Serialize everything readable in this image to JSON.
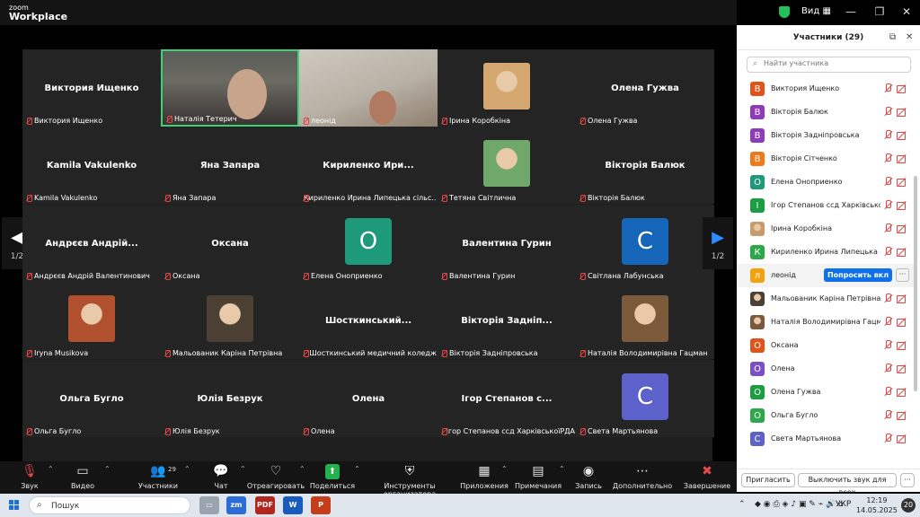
{
  "titlebar": {
    "brand_top": "zoom",
    "brand_bottom": "Workplace",
    "view_label": "Вид"
  },
  "gallery": {
    "page_left": "1/2",
    "page_right": "1/2",
    "tiles": [
      {
        "name": "Виктория  Ищенко",
        "label": "Виктория Ищенко",
        "kind": "name"
      },
      {
        "name": "",
        "label": "Наталія Тетерич",
        "kind": "video1"
      },
      {
        "name": "",
        "label": "леонід",
        "kind": "video2"
      },
      {
        "name": "",
        "label": "Ірина Коробкіна",
        "kind": "photo",
        "photo_color": "#d4a770"
      },
      {
        "name": "Олена Гужва",
        "label": "Олена Гужва",
        "kind": "name"
      },
      {
        "name": "Kamila Vakulenko",
        "label": "Kamila Vakulenko",
        "kind": "name"
      },
      {
        "name": "Яна Запара",
        "label": "Яна Запара",
        "kind": "name"
      },
      {
        "name": "Кириленко  Ири...",
        "label": "Кириленко Ирина Липецька сільс...",
        "kind": "name"
      },
      {
        "name": "",
        "label": "Тетяна Світлична",
        "kind": "photo",
        "photo_color": "#6fa86a"
      },
      {
        "name": "Вікторія Балюк",
        "label": "Вікторія Балюк",
        "kind": "name"
      },
      {
        "name": "Андрєєв  Андрій...",
        "label": "Андрєєв Андрій Валентинович",
        "kind": "name"
      },
      {
        "name": "Оксана",
        "label": "Оксана",
        "kind": "name"
      },
      {
        "name": "",
        "label": "Елена Оноприенко",
        "kind": "avatar",
        "letter": "О",
        "color": "#1e9a7a"
      },
      {
        "name": "Валентина Гурин",
        "label": "Валентина Гурин",
        "kind": "name"
      },
      {
        "name": "",
        "label": "Світлана Лабунська",
        "kind": "avatar",
        "letter": "С",
        "color": "#1565b8"
      },
      {
        "name": "",
        "label": "Iryna Musikova",
        "kind": "photo",
        "photo_color": "#b0502e"
      },
      {
        "name": "",
        "label": "Мальованик Каріна Петрівна",
        "kind": "photo",
        "photo_color": "#4c4034"
      },
      {
        "name": "Шосткинський...",
        "label": "Шосткинський медичний коледж",
        "kind": "name"
      },
      {
        "name": "Вікторія  Задніп...",
        "label": "Вікторія Задніпровська",
        "kind": "name"
      },
      {
        "name": "",
        "label": "Наталія Володимирівна Гацман",
        "kind": "photo",
        "photo_color": "#7a5a3a"
      },
      {
        "name": "Ольга Бугло",
        "label": "Ольга Бугло",
        "kind": "name"
      },
      {
        "name": "Юлія Безрук",
        "label": "Юлія Безрук",
        "kind": "name"
      },
      {
        "name": "Олена",
        "label": "Олена",
        "kind": "name"
      },
      {
        "name": "Ігор  Степанов  с...",
        "label": "Ігор Степанов ссд ХарківськоїРДА",
        "kind": "name"
      },
      {
        "name": "",
        "label": "Света Мартьянова",
        "kind": "avatar",
        "letter": "С",
        "color": "#5c62c9"
      }
    ]
  },
  "toolbar": {
    "items": [
      {
        "label": "Звук",
        "icon": "mic-muted-icon",
        "glyph": "🎙"
      },
      {
        "label": "Видео",
        "icon": "video-icon",
        "glyph": "▭"
      },
      {
        "label": "Участники",
        "icon": "participants-icon",
        "glyph": "👥",
        "count": "29"
      },
      {
        "label": "Чат",
        "icon": "chat-icon",
        "glyph": "💬"
      },
      {
        "label": "Отреагировать",
        "icon": "heart-icon",
        "glyph": "♡"
      },
      {
        "label": "Поделиться",
        "icon": "share-icon",
        "glyph": "⬆"
      },
      {
        "label": "Инструменты организатора",
        "icon": "shield-icon",
        "glyph": "⛨"
      },
      {
        "label": "Приложения",
        "icon": "apps-icon",
        "glyph": "▦"
      },
      {
        "label": "Примечания",
        "icon": "notes-icon",
        "glyph": "▤"
      },
      {
        "label": "Запись",
        "icon": "record-icon",
        "glyph": "◉"
      },
      {
        "label": "Дополнительно",
        "icon": "more-icon",
        "glyph": "⋯"
      },
      {
        "label": "Завершение",
        "icon": "end-icon",
        "glyph": "✖"
      }
    ]
  },
  "panel": {
    "title": "Участники (29)",
    "search_placeholder": "Найти участника",
    "ask_label": "Попросить вкл",
    "more_label": "···",
    "invite_label": "Пригласить",
    "mute_all_label": "Выключить звук для всех",
    "participants": [
      {
        "letter": "В",
        "name": "Виктория Ищенко",
        "color": "#e0541c"
      },
      {
        "letter": "В",
        "name": "Вікторія Балюк",
        "color": "#8e3bb8"
      },
      {
        "letter": "В",
        "name": "Вікторія Задніпровська",
        "color": "#8e3bb8"
      },
      {
        "letter": "В",
        "name": "Вікторія Сітченко",
        "color": "#f07a1a"
      },
      {
        "letter": "О",
        "name": "Елена Оноприенко",
        "color": "#1e9a7a"
      },
      {
        "letter": "І",
        "name": "Ігор Степанов ссд Харківської...",
        "color": "#1b9e42"
      },
      {
        "letter": "",
        "name": "Ірина Коробкіна",
        "color": "#c99a6a"
      },
      {
        "letter": "К",
        "name": "Кириленко Ирина Липецька сі...",
        "color": "#2ca84a"
      },
      {
        "letter": "л",
        "name": "леонід",
        "color": "#f2a20f"
      },
      {
        "letter": "",
        "name": "Мальованик Каріна Петрівна",
        "color": "#4c4034"
      },
      {
        "letter": "",
        "name": "Наталія Володимирівна Гацман",
        "color": "#7a5a3a"
      },
      {
        "letter": "О",
        "name": "Оксана",
        "color": "#e0541c"
      },
      {
        "letter": "О",
        "name": "Олена",
        "color": "#7b4fc8"
      },
      {
        "letter": "О",
        "name": "Олена Гужва",
        "color": "#1b9e42"
      },
      {
        "letter": "О",
        "name": "Ольга Бугло",
        "color": "#2ca84a"
      },
      {
        "letter": "С",
        "name": "Света Мартьянова",
        "color": "#5c62c9"
      }
    ]
  },
  "taskbar": {
    "search_text": "Пошук",
    "lang": "УКР",
    "time": "12:19",
    "date": "14.05.2025",
    "notifications": "20"
  }
}
